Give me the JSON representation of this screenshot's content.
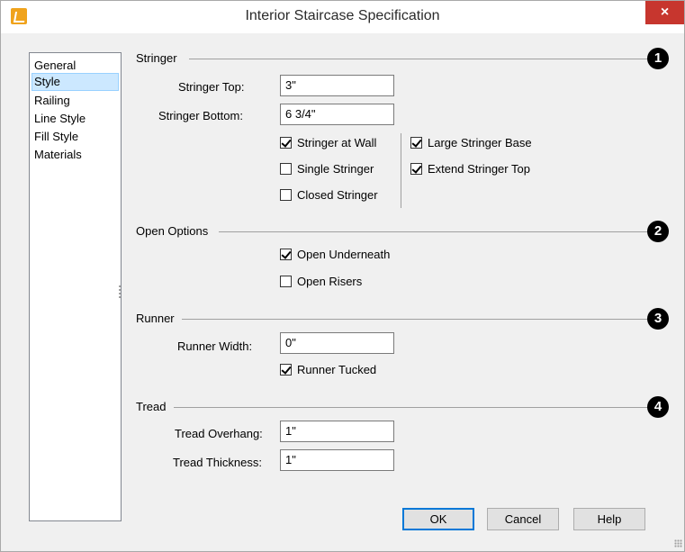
{
  "window": {
    "title": "Interior Staircase Specification",
    "close_glyph": "×"
  },
  "sidebar": {
    "items": [
      {
        "label": "General",
        "selected": false
      },
      {
        "label": "Style",
        "selected": true
      },
      {
        "label": "Railing",
        "selected": false
      },
      {
        "label": "Line Style",
        "selected": false
      },
      {
        "label": "Fill Style",
        "selected": false
      },
      {
        "label": "Materials",
        "selected": false
      }
    ]
  },
  "stringer": {
    "heading": "Stringer",
    "badge": "1",
    "top_label": "Stringer Top:",
    "top_value": "3\"",
    "bottom_label": "Stringer Bottom:",
    "bottom_value": "6 3/4\"",
    "at_wall": {
      "label": "Stringer at Wall",
      "checked": true
    },
    "single": {
      "label": "Single Stringer",
      "checked": false
    },
    "closed": {
      "label": "Closed Stringer",
      "checked": false
    },
    "large_base": {
      "label": "Large Stringer Base",
      "checked": true
    },
    "extend_top": {
      "label": "Extend Stringer Top",
      "checked": true
    }
  },
  "open_options": {
    "heading": "Open Options",
    "badge": "2",
    "underneath": {
      "label": "Open Underneath",
      "checked": true
    },
    "risers": {
      "label": "Open Risers",
      "checked": false
    }
  },
  "runner": {
    "heading": "Runner",
    "badge": "3",
    "width_label": "Runner Width:",
    "width_value": "0\"",
    "tucked": {
      "label": "Runner Tucked",
      "checked": true
    }
  },
  "tread": {
    "heading": "Tread",
    "badge": "4",
    "overhang_label": "Tread Overhang:",
    "overhang_value": "1\"",
    "thickness_label": "Tread Thickness:",
    "thickness_value": "1\""
  },
  "buttons": {
    "ok": "OK",
    "cancel": "Cancel",
    "help": "Help"
  },
  "colors": {
    "accent": "#0078d7",
    "close": "#c7362e",
    "selection": "#cce8ff"
  }
}
